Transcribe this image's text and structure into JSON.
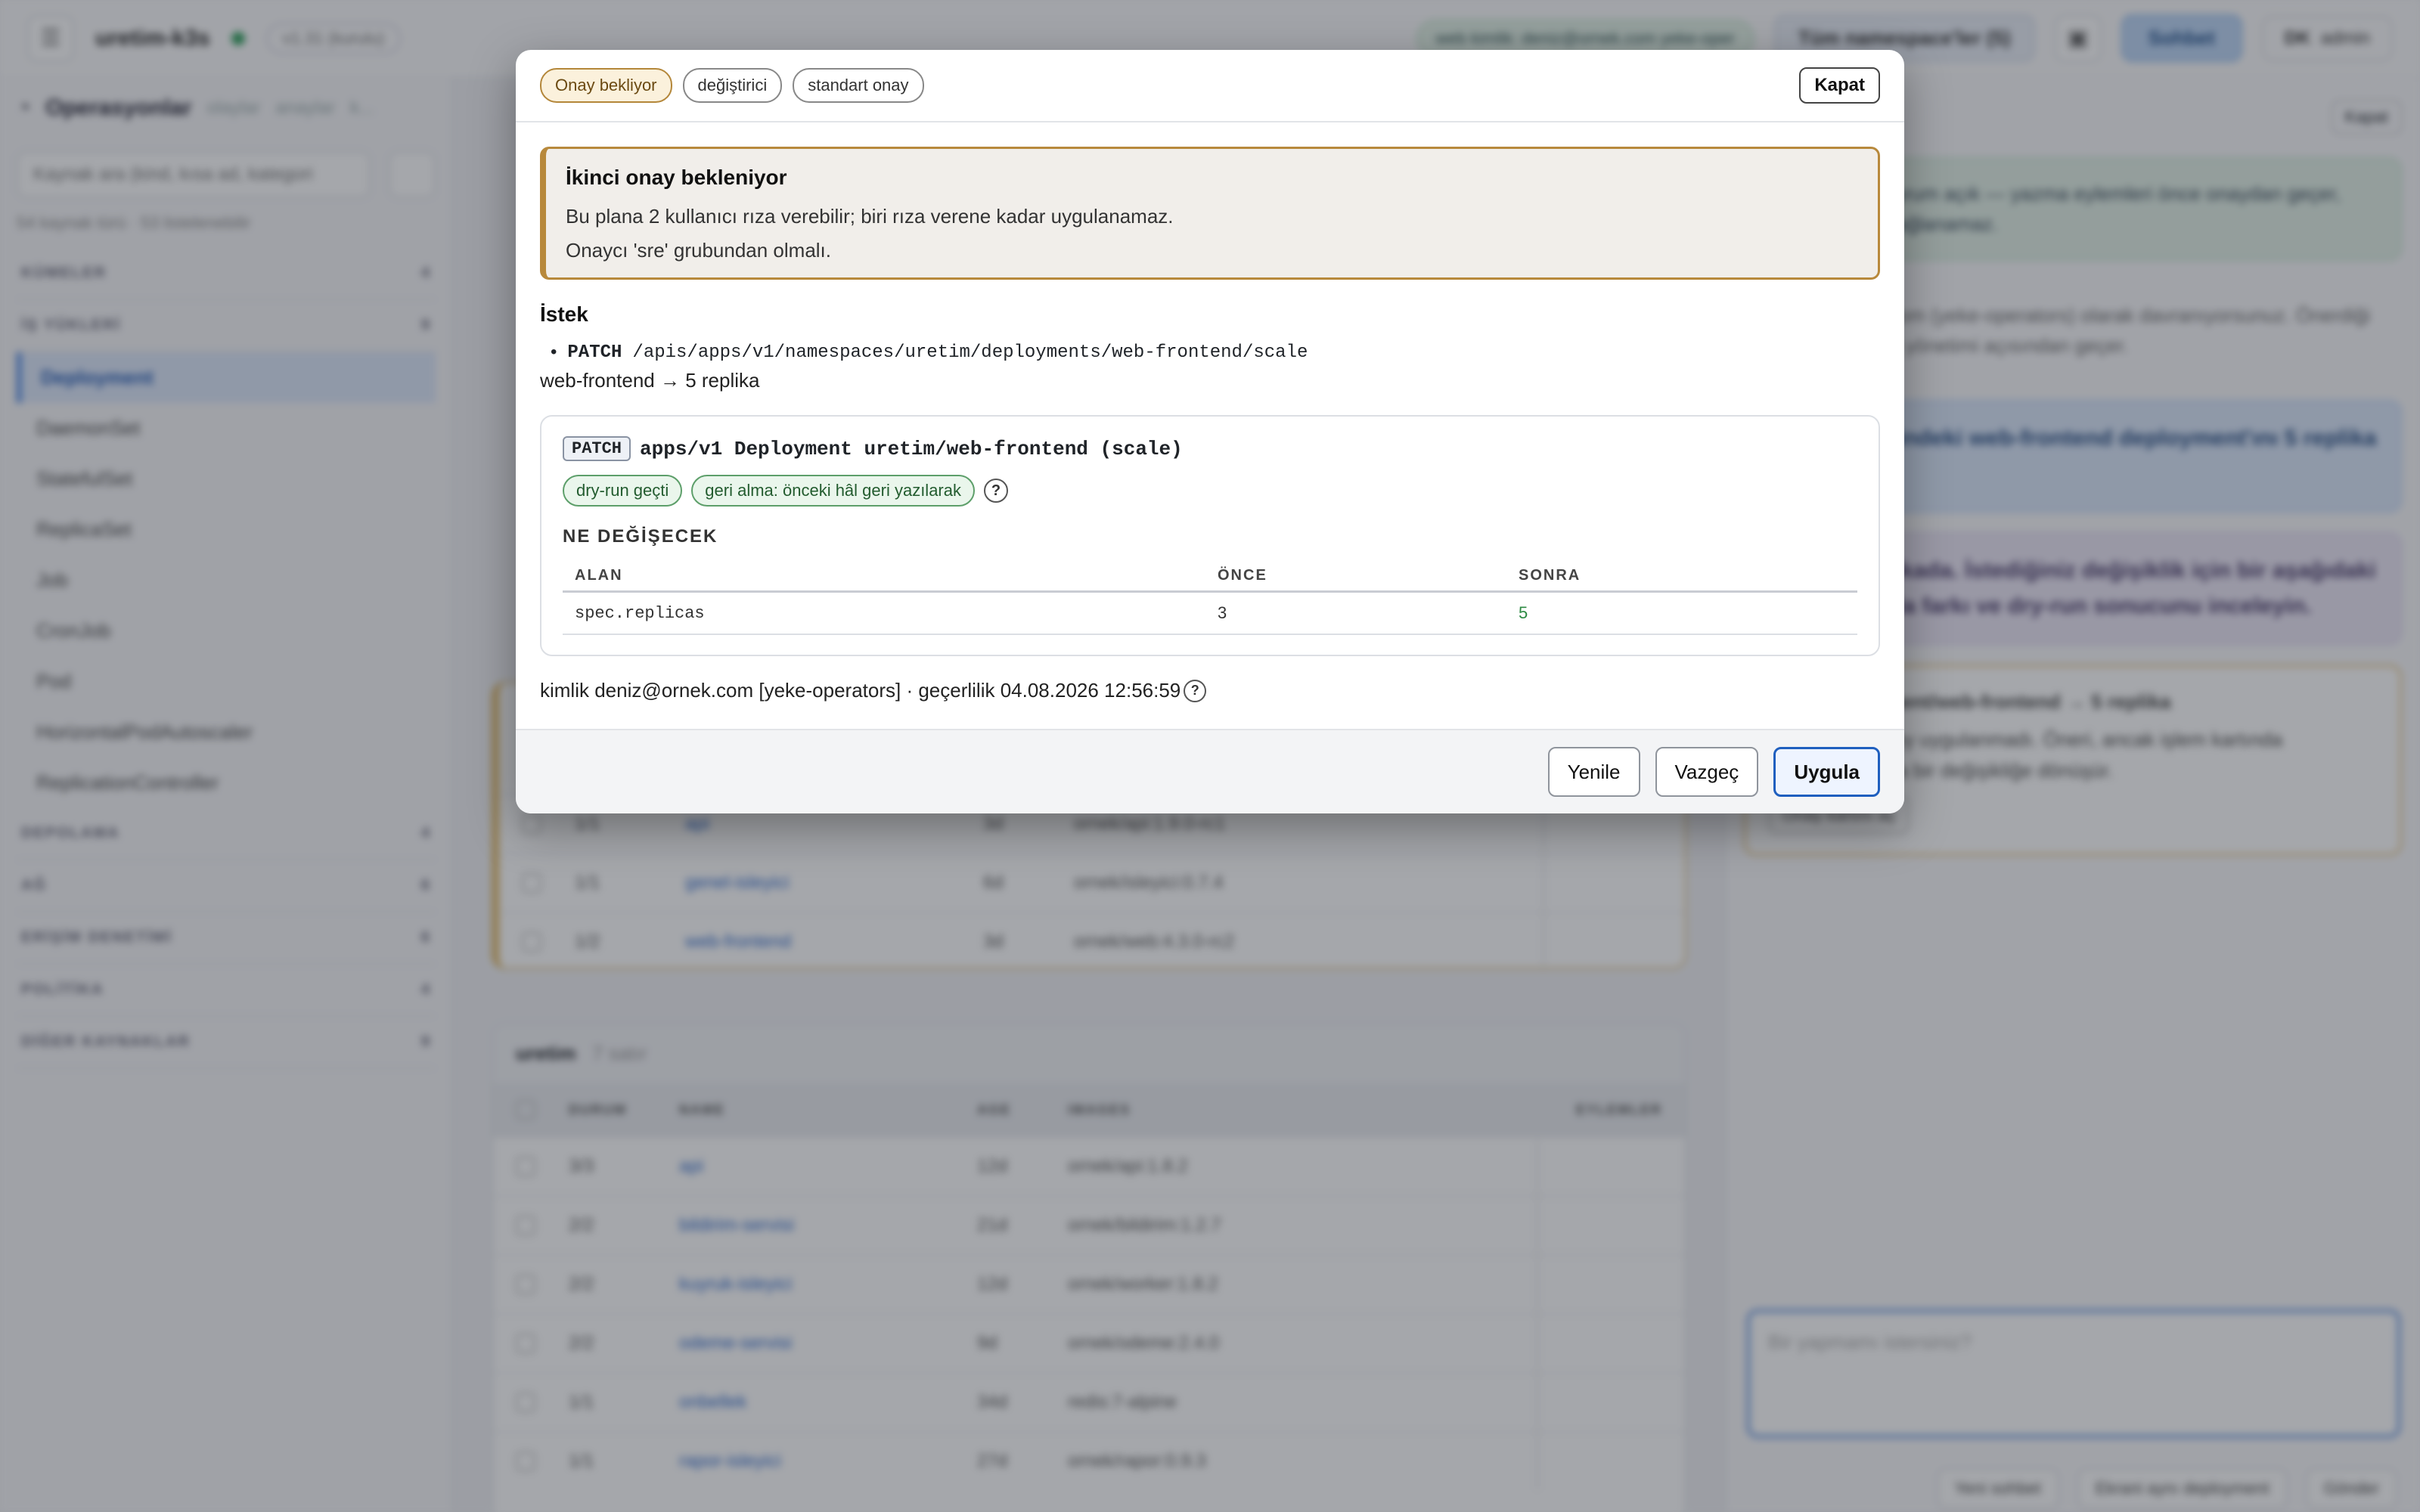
{
  "background": {
    "topbar": {
      "context_name": "uretim-k3s",
      "chip": "v1.31 (kurulu)",
      "identity_chip": "web  kimlik:  deniz@ornek.com  yeke-oper",
      "namespace_select": "Tüm namespace'ler (5)",
      "chat_button": "Sohbet",
      "user_initials": "DK",
      "user_role": "admin"
    },
    "sidebar": {
      "title": "Operasyonlar",
      "title_links": [
        "olaylar",
        "anaylar",
        "k..."
      ],
      "search_placeholder": "Kaynak ara (kind, kısa ad, kategori",
      "meta": "54 kaynak türü · 53 listelenebilir",
      "groups_top": [
        {
          "label": "KÜMELER",
          "count": "4"
        },
        {
          "label": "İŞ YÜKLERİ",
          "count": "9"
        }
      ],
      "workload_items": [
        "Deployment",
        "DaemonSet",
        "StatefulSet",
        "ReplicaSet",
        "Job",
        "CronJob",
        "Pod",
        "HorizontalPodAutoscaler",
        "ReplicationController"
      ],
      "groups_bottom": [
        {
          "label": "DEPOLAMA",
          "count": "4"
        },
        {
          "label": "AĞ",
          "count": "6"
        },
        {
          "label": "ERİŞİM DENETİMİ",
          "count": "6"
        },
        {
          "label": "POLİTİKA",
          "count": "4"
        },
        {
          "label": "DİĞER KAYNAKLAR",
          "count": "9"
        }
      ]
    },
    "table_top_rows": [
      {
        "status": "1/1",
        "name": "api",
        "age": "3d",
        "image": "ornek/api:1.9.0-rc1"
      },
      {
        "status": "1/1",
        "name": "genel-isleyici",
        "age": "6d",
        "image": "ornek/isleyici:0.7.4"
      },
      {
        "status": "1/2",
        "name": "web-frontend",
        "age": "3d",
        "image": "ornek/web:4.3.0-rc2"
      }
    ],
    "table_bottom": {
      "namespace": "uretim",
      "row_count": "7 satır",
      "columns": [
        "DURUM",
        "NAME",
        "AGE",
        "IMAGES",
        "EYLEMLER"
      ],
      "rows": [
        {
          "status": "3/3",
          "name": "api",
          "age": "12d",
          "image": "ornek/api:1.8.2"
        },
        {
          "status": "2/2",
          "name": "bildirim-servisi",
          "age": "21d",
          "image": "ornek/bildirim:1.2.7"
        },
        {
          "status": "2/2",
          "name": "kuyruk-isleyici",
          "age": "12d",
          "image": "ornek/worker:1.8.2"
        },
        {
          "status": "2/2",
          "name": "odeme-servisi",
          "age": "9d",
          "image": "ornek/odeme:2.4.0"
        },
        {
          "status": "1/1",
          "name": "onbellek",
          "age": "34d",
          "image": "redis:7-alpine"
        },
        {
          "status": "1/1",
          "name": "rapor-isleyici",
          "age": "27d",
          "image": "ornek/rapor:0.9.3"
        }
      ]
    },
    "chat": {
      "close": "Kapat",
      "msg1": "uretim-k3s · oturum açık — yazma eylemleri önce onaydan geçer, özel bir IP'ye bağlanamaz.",
      "msg2": "deniz@ornek.com (yeke-operators) olarak davranıyorsunuz. Önerdiği her yazma, site yönetimi açısından geçer.",
      "msg3": "namespace'indeki web-frontend deployment'ını 5 replika çıkar",
      "msg4": "şu an 3 replikada. İstediğiniz değişiklik için bir aşağıdaki onay kartında farkı ve dry-run sonucunu inceleyin.",
      "card_title": "apps deployment/web-frontend → 5 replika",
      "card_text": "Henüz hiçbir şey uygulanmadı. Öneri, ancak işlem kartında onayladığınızda bir değişikliğe dönüşür.",
      "card_button": "Onay kartını aç",
      "input_placeholder": "Bir yapmamı istersiniz?",
      "actions": [
        "Yeni sohbet",
        "Ekrani aynı deployment",
        "Gönder"
      ]
    }
  },
  "modal": {
    "badges": {
      "status": "Onay bekliyor",
      "kind": "değiştirici",
      "policy": "standart onay"
    },
    "close_label": "Kapat",
    "warning": {
      "title": "İkinci onay bekleniyor",
      "line1": "Bu plana 2 kullanıcı rıza verebilir; biri rıza verene kadar uygulanamaz.",
      "line2": "Onaycı 'sre' grubundan olmalı."
    },
    "request": {
      "heading": "İstek",
      "bullet": "•",
      "verb": "PATCH",
      "path": "/apis/apps/v1/namespaces/uretim/deployments/web-frontend/scale",
      "summary": "web-frontend → 5 replika"
    },
    "operation": {
      "verb": "PATCH",
      "title": "apps/v1 Deployment uretim/web-frontend (scale)",
      "chip_dryrun": "dry-run geçti",
      "chip_rollback": "geri alma: önceki hâl geri yazılarak",
      "help": "?",
      "changes_heading": "NE DEĞİŞECEK",
      "columns": [
        "ALAN",
        "ÖNCE",
        "SONRA"
      ],
      "rows": [
        {
          "field": "spec.replicas",
          "before": "3",
          "after": "5"
        }
      ]
    },
    "identity": "kimlik deniz@ornek.com [yeke-operators] · geçerlilik 04.08.2026 12:56:59",
    "identity_help": "?",
    "footer": {
      "refresh": "Yenile",
      "cancel": "Vazgeç",
      "apply": "Uygula"
    }
  }
}
